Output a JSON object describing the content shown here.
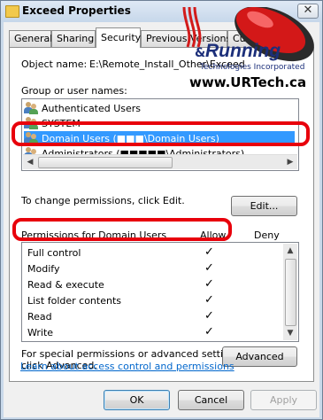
{
  "window": {
    "title": "Exceed Properties",
    "close_glyph": "✕"
  },
  "tabs": [
    "General",
    "Sharing",
    "Security",
    "Previous Versions",
    "Customize"
  ],
  "security": {
    "object_name_label": "Object name:",
    "object_name_value": "E:\\Remote_Install_Other\\Exceed",
    "groups_label": "Group or user names:",
    "groups": [
      "Authenticated Users",
      "SYSTEM",
      "Domain Users (■■■\\Domain Users)",
      "Administrators (■■■■■\\Administrators)"
    ],
    "selected_group_index": 2,
    "change_text": "To change permissions, click Edit.",
    "edit_button": "Edit...",
    "permissions_label": "Permissions for Domain Users",
    "allow_header": "Allow",
    "deny_header": "Deny",
    "permissions": [
      {
        "name": "Full control",
        "allow": true,
        "deny": false
      },
      {
        "name": "Modify",
        "allow": true,
        "deny": false
      },
      {
        "name": "Read & execute",
        "allow": true,
        "deny": false
      },
      {
        "name": "List folder contents",
        "allow": true,
        "deny": false
      },
      {
        "name": "Read",
        "allow": true,
        "deny": false
      },
      {
        "name": "Write",
        "allow": true,
        "deny": false
      }
    ],
    "check_glyph": "✓",
    "advanced_text_line1": "For special permissions or advanced settings,",
    "advanced_text_line2": "click Advanced.",
    "advanced_button": "Advanced",
    "learn_link": "Learn about access control and permissions"
  },
  "buttons": {
    "ok": "OK",
    "cancel": "Cancel",
    "apply": "Apply"
  },
  "watermark": {
    "ampersand": "&",
    "brand": "Running",
    "tagline": "Technologies Incorporated",
    "url": "www.URTech.ca"
  },
  "colors": {
    "selection": "#3399ff",
    "highlight_outline": "#e8000b",
    "link": "#0066cc"
  }
}
